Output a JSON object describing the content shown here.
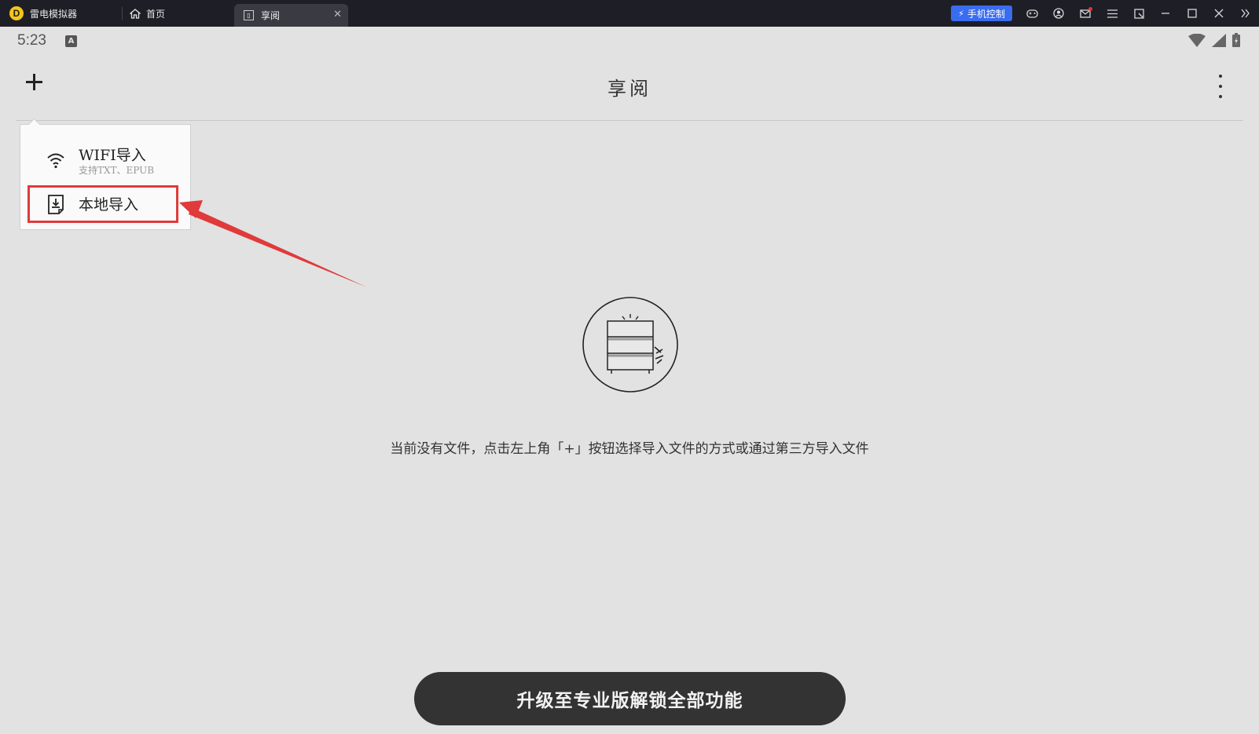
{
  "emulator": {
    "brand": "雷电模拟器",
    "tabs": [
      {
        "label": "首页",
        "icon": "home-icon"
      },
      {
        "label": "享阅",
        "icon": "book-icon"
      }
    ],
    "phone_control": "手机控制",
    "toolbar_icons": [
      "gamepad-icon",
      "account-icon",
      "mail-icon",
      "menu-icon",
      "screen-icon",
      "minimize-icon",
      "maximize-icon",
      "close-icon",
      "sidebar-expand-icon"
    ]
  },
  "status": {
    "time": "5:23",
    "badge": "A",
    "icons": [
      "wifi-icon",
      "signal-icon",
      "battery-icon"
    ]
  },
  "app": {
    "title": "享阅",
    "empty_message": "当前没有文件，点击左上角「+」按钮选择导入文件的方式或通过第三方导入文件",
    "upgrade_button": "升级至专业版解锁全部功能"
  },
  "menu": {
    "wifi_import": {
      "label": "WIFI导入",
      "sub": "支持TXT、EPUB"
    },
    "local_import": {
      "label": "本地导入"
    }
  },
  "colors": {
    "background": "#e2e2e2",
    "topbar": "#1e1f26",
    "accent_blue": "#3a6cf0",
    "annotation_red": "#e03a3a",
    "button_dark": "#333333"
  }
}
